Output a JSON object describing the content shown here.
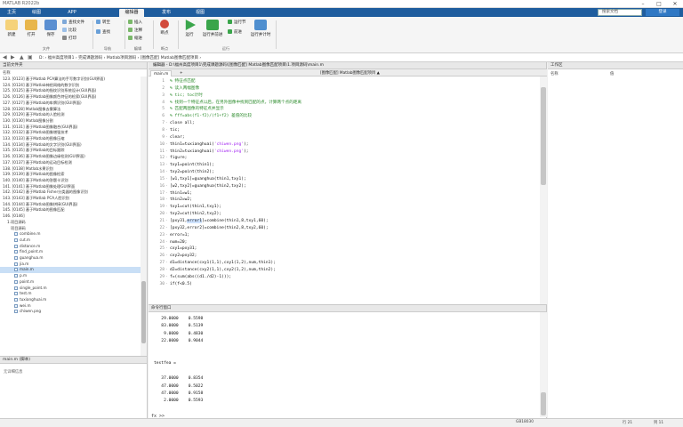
{
  "app": {
    "title": "MATLAB R2022b",
    "min": "–",
    "max": "□",
    "close": "✕"
  },
  "tabs": [
    "主页",
    "绘图",
    "APP",
    "编辑器",
    "发布",
    "视图"
  ],
  "search_placeholder": "搜索文档",
  "login_label": "登录",
  "ribbon": {
    "new": "新建",
    "open": "打开",
    "save": "保存",
    "find_file": "查找文件",
    "compare": "比较",
    "print": "打印",
    "goto": "转至",
    "find": "查找",
    "insert": "插入",
    "comment": "注释",
    "indent": "缩进",
    "breakpoint": "断点",
    "run": "运行",
    "run_advance": "运行并前进",
    "run_section": "运行节",
    "advance": "前进",
    "run_time": "运行并计时",
    "groups": {
      "file": "文件",
      "navigate": "导航",
      "edit": "编辑",
      "breakpoints": "断点",
      "run": "运行"
    }
  },
  "address": {
    "path": "D: › 福州高度项目1 › 完成课题源码 › Matlab项目源码 › [图像匹配] Matlab图像匹配项目 ›"
  },
  "current_folder": {
    "title": "当前文件夹",
    "column": "名称",
    "rows": [
      "123. [0123] 基于Matlab PCA算法的手写数字识别(GUI界面)",
      "124. [0124] 基于Matlab神经网络的数字识别",
      "125. [0125] 基于Matlab的指纹识别系统设计(GUI界面)",
      "126. [0126] 基于Matlab图像颜色特征的检索(GUI界面)",
      "127. [0127] 基于Matlab的车牌识别(GUI界面)",
      "128. [0128] Matlab图像去雾算法",
      "129. [0129] 基于Matlab的人脸检测",
      "130. [0130] Matlab图像分割",
      "131. [0131] 基于Matlab图像融合(GUI界面)",
      "132. [0132] 基于Matlab图像增强技术",
      "133. [0133] 基于Matlab的图像压缩",
      "134. [0134] 基于Matlab的文字识别(GUI界面)",
      "135. [0135] 基于Matlab的目标跟踪",
      "136. [0136] 基于Matlab图像边缘检测(GUI界面)",
      "137. [0137] 基于Matlab的运动目标检测",
      "138. [0138] Matlab水果识别",
      "139. [0139] 基于Matlab的图像检索",
      "140. [0140] 基于Matlab的答题卡识别",
      "141. [0141] 基于Matlab图像处理GUI界面",
      "142. [0142] 基于Matlab Fisher分类器的图像识别",
      "143. [0143] 基于Matlab PCA人脸识别",
      "144. [0144] 基于Matlab图像拼接(GUI界面)",
      "145. [0145] 基于Matlab的图像匹配",
      "146. [0146]"
    ],
    "subfolder": "1.项目源码",
    "subsub": "项目源码",
    "files": [
      "combine.m",
      "cut.m",
      "distance.m",
      "find_point.m",
      "guanghua.m",
      "jia.m",
      "main.m",
      "p.m",
      "point.m",
      "single_point.m",
      "test.m",
      "tuxianghuai.m",
      "wei.m",
      "chiwen.png"
    ],
    "selected_file": "main.m"
  },
  "detail": {
    "title": "main.m  (脚本)",
    "sub": "无详细信息"
  },
  "editor": {
    "header": "编辑器 - D:\\福州高度项目1\\完成课题源码\\[图像匹配] Matlab图像匹配项目\\1.项目源码\\main.m",
    "tabs": [
      "main.m",
      "+"
    ],
    "tab2": "[图像匹配] Matlab图像匹配项目 ▲",
    "lines": [
      {
        "n": "1",
        "m": "",
        "t": "% 特征点匹配",
        "c": true
      },
      {
        "n": "2",
        "m": "",
        "t": "% 读入两幅图像",
        "c": true
      },
      {
        "n": "3",
        "m": "",
        "t": "% tic; toc计时",
        "c": true
      },
      {
        "n": "4",
        "m": "",
        "t": "% 找到一个特征点以后，在另外图像中找到匹配的点，计算两个点的距离",
        "c": true
      },
      {
        "n": "5",
        "m": "",
        "t": "% 匹配两图像的特征点并显示",
        "c": true
      },
      {
        "n": "6",
        "m": "",
        "t": "% fff=abs(f1-f2)/(f1+f2) 差值的比较",
        "c": true
      },
      {
        "n": "7",
        "m": "-",
        "t": "close all;"
      },
      {
        "n": "8",
        "m": "-",
        "t": "tic;"
      },
      {
        "n": "9",
        "m": "-",
        "t": "clear;"
      },
      {
        "n": "10",
        "m": "-",
        "t": "thin1=tuxianghuai('chiwen.png');",
        "s": true
      },
      {
        "n": "11",
        "m": "-",
        "t": "thin2=tuxianghuai('chiwen.png');",
        "s": true
      },
      {
        "n": "12",
        "m": "-",
        "t": "figure;"
      },
      {
        "n": "13",
        "m": "-",
        "t": "txy1=point(thin1);"
      },
      {
        "n": "14",
        "m": "-",
        "t": "txy2=point(thin2);"
      },
      {
        "n": "15",
        "m": "-",
        "t": "[w1,txy1]=guanghua(thin1,txy1);"
      },
      {
        "n": "16",
        "m": "-",
        "t": "[w2,txy2]=guanghua(thin2,txy2);"
      },
      {
        "n": "17",
        "m": "-",
        "t": "thin1=w1;"
      },
      {
        "n": "18",
        "m": "-",
        "t": "thin2=w2;"
      },
      {
        "n": "19",
        "m": "-",
        "t": "txy1=cut(thin1,txy1);"
      },
      {
        "n": "20",
        "m": "-",
        "t": "txy2=cut(thin2,txy2);"
      },
      {
        "n": "21",
        "m": "-",
        "t": "[pxy31,error1]=combine(thin1,8,txy1,60);",
        "h": true
      },
      {
        "n": "22",
        "m": "-",
        "t": "[pxy32,error2]=combine(thin2,8,txy2,60);"
      },
      {
        "n": "23",
        "m": "-",
        "t": "error=1;"
      },
      {
        "n": "24",
        "m": "-",
        "t": "num=20;"
      },
      {
        "n": "25",
        "m": "-",
        "t": "cxy1=pxy31;"
      },
      {
        "n": "26",
        "m": "-",
        "t": "cxy2=pxy32;"
      },
      {
        "n": "27",
        "m": "-",
        "t": "d1=distance(cxy1(1,1),cxy1(1,2),num,thin1);"
      },
      {
        "n": "28",
        "m": "-",
        "t": "d2=distance(cxy2(1,1),cxy2(1,2),num,thin2);"
      },
      {
        "n": "29",
        "m": "-",
        "t": "f=(sum(abs((d1./d2)-1)));"
      },
      {
        "n": "30",
        "m": "-",
        "t": "if(f<0.5)"
      }
    ]
  },
  "command": {
    "title": "命令行窗口",
    "rows": [
      "   29.0000    0.5598",
      "   83.0000    0.5139",
      "    9.0000    0.4830",
      "   22.0000    0.9044",
      "",
      "",
      "testfea =",
      "",
      "   37.0000    0.8354",
      "   47.0000    0.5022",
      "   47.0000    0.9158",
      "    2.0000    0.5593"
    ],
    "prompt": "fx >>"
  },
  "workspace": {
    "title": "工作区",
    "col1": "名称",
    "col2": "值"
  },
  "status": {
    "text": "",
    "enc": "GB18030",
    "ln": "行 21",
    "col": "列 11"
  }
}
